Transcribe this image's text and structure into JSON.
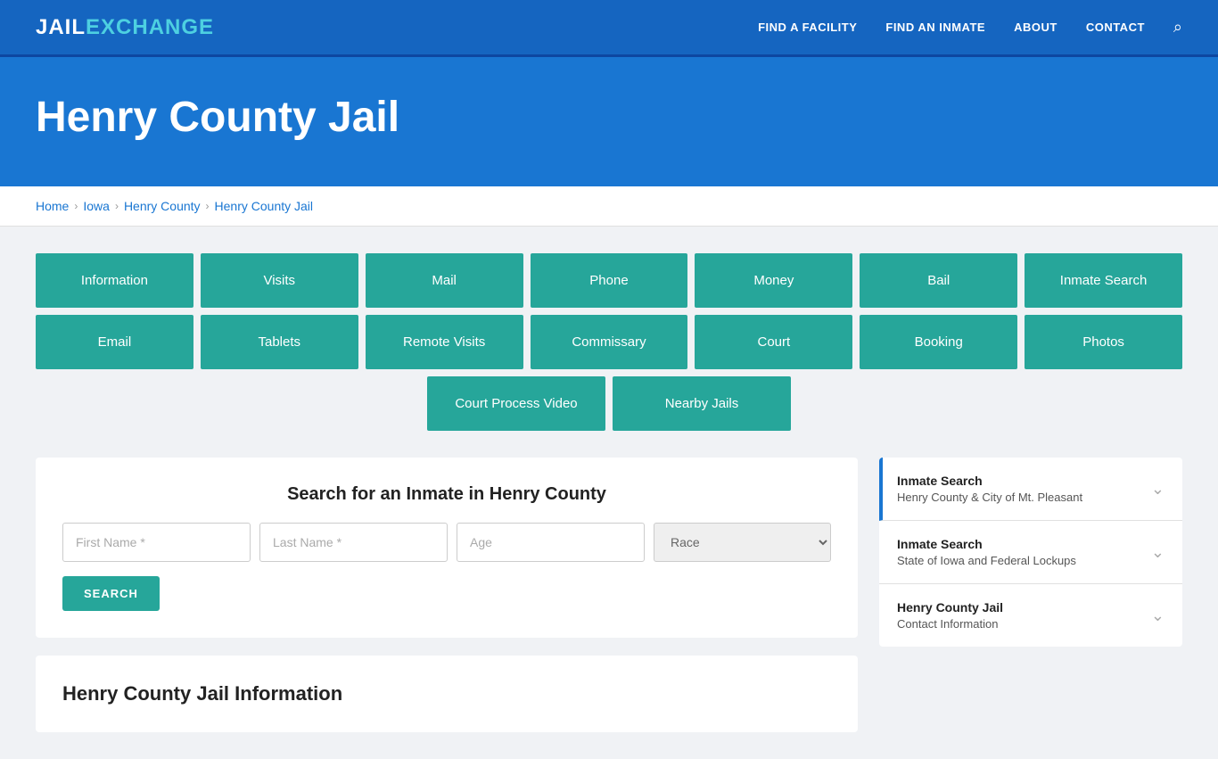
{
  "navbar": {
    "logo_jail": "JAIL",
    "logo_exchange": "EXCHANGE",
    "links": [
      {
        "label": "FIND A FACILITY",
        "href": "#"
      },
      {
        "label": "FIND AN INMATE",
        "href": "#"
      },
      {
        "label": "ABOUT",
        "href": "#"
      },
      {
        "label": "CONTACT",
        "href": "#"
      }
    ]
  },
  "hero": {
    "title": "Henry County Jail"
  },
  "breadcrumb": {
    "items": [
      {
        "label": "Home",
        "href": "#"
      },
      {
        "label": "Iowa",
        "href": "#"
      },
      {
        "label": "Henry County",
        "href": "#"
      },
      {
        "label": "Henry County Jail",
        "href": "#"
      }
    ]
  },
  "nav_buttons_row1": [
    {
      "label": "Information"
    },
    {
      "label": "Visits"
    },
    {
      "label": "Mail"
    },
    {
      "label": "Phone"
    },
    {
      "label": "Money"
    },
    {
      "label": "Bail"
    },
    {
      "label": "Inmate Search"
    }
  ],
  "nav_buttons_row2": [
    {
      "label": "Email"
    },
    {
      "label": "Tablets"
    },
    {
      "label": "Remote Visits"
    },
    {
      "label": "Commissary"
    },
    {
      "label": "Court"
    },
    {
      "label": "Booking"
    },
    {
      "label": "Photos"
    }
  ],
  "nav_buttons_row3": [
    {
      "label": "Court Process Video"
    },
    {
      "label": "Nearby Jails"
    }
  ],
  "search": {
    "title": "Search for an Inmate in Henry County",
    "first_name_placeholder": "First Name *",
    "last_name_placeholder": "Last Name *",
    "age_placeholder": "Age",
    "race_placeholder": "Race",
    "button_label": "SEARCH"
  },
  "info_section": {
    "title": "Henry County Jail Information"
  },
  "sidebar": {
    "items": [
      {
        "title": "Inmate Search",
        "subtitle": "Henry County & City of Mt. Pleasant",
        "active": true
      },
      {
        "title": "Inmate Search",
        "subtitle": "State of Iowa and Federal Lockups",
        "active": false
      },
      {
        "title": "Henry County Jail",
        "subtitle": "Contact Information",
        "active": false
      }
    ]
  }
}
